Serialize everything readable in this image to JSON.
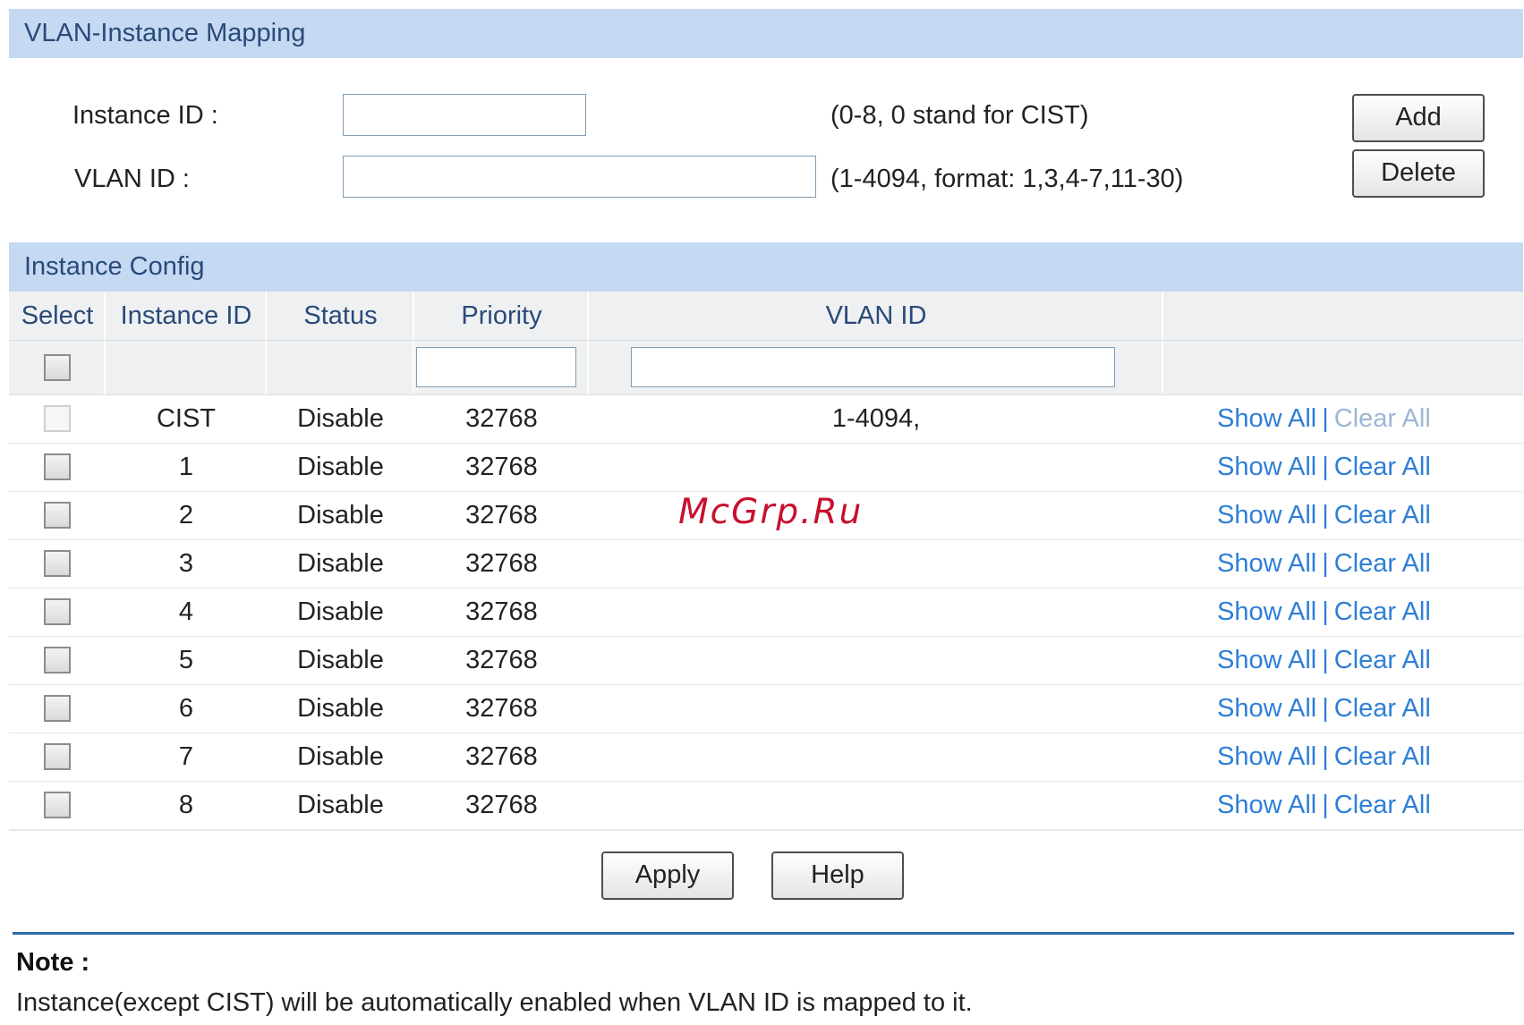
{
  "mapping": {
    "header": "VLAN-Instance Mapping",
    "instance_id_label": "Instance ID :",
    "instance_id_value": "",
    "instance_id_hint": "(0-8, 0 stand for CIST)",
    "vlan_id_label": "VLAN ID :",
    "vlan_id_value": "",
    "vlan_id_hint": "(1-4094, format: 1,3,4-7,11-30)",
    "add_label": "Add",
    "delete_label": "Delete"
  },
  "config": {
    "header": "Instance Config",
    "columns": {
      "select": "Select",
      "instance_id": "Instance ID",
      "status": "Status",
      "priority": "Priority",
      "vlan_id": "VLAN ID"
    },
    "filter": {
      "priority": "",
      "vlan_id": ""
    },
    "rows": [
      {
        "instance": "CIST",
        "status": "Disable",
        "priority": "32768",
        "vlan": "1-4094,",
        "show": "Show All",
        "clear": "Clear All",
        "select_disabled": true
      },
      {
        "instance": "1",
        "status": "Disable",
        "priority": "32768",
        "vlan": "",
        "show": "Show All",
        "clear": "Clear All",
        "select_disabled": false
      },
      {
        "instance": "2",
        "status": "Disable",
        "priority": "32768",
        "vlan": "",
        "show": "Show All",
        "clear": "Clear All",
        "select_disabled": false
      },
      {
        "instance": "3",
        "status": "Disable",
        "priority": "32768",
        "vlan": "",
        "show": "Show All",
        "clear": "Clear All",
        "select_disabled": false
      },
      {
        "instance": "4",
        "status": "Disable",
        "priority": "32768",
        "vlan": "",
        "show": "Show All",
        "clear": "Clear All",
        "select_disabled": false
      },
      {
        "instance": "5",
        "status": "Disable",
        "priority": "32768",
        "vlan": "",
        "show": "Show All",
        "clear": "Clear All",
        "select_disabled": false
      },
      {
        "instance": "6",
        "status": "Disable",
        "priority": "32768",
        "vlan": "",
        "show": "Show All",
        "clear": "Clear All",
        "select_disabled": false
      },
      {
        "instance": "7",
        "status": "Disable",
        "priority": "32768",
        "vlan": "",
        "show": "Show All",
        "clear": "Clear All",
        "select_disabled": false
      },
      {
        "instance": "8",
        "status": "Disable",
        "priority": "32768",
        "vlan": "",
        "show": "Show All",
        "clear": "Clear All",
        "select_disabled": false
      }
    ],
    "link_separator": "|",
    "apply_label": "Apply",
    "help_label": "Help"
  },
  "watermark": "McGrp.Ru",
  "note": {
    "title": "Note :",
    "text": "Instance(except CIST) will be automatically enabled when VLAN ID is mapped to it."
  },
  "colors": {
    "header_bg": "#c6d9f3",
    "header_text": "#2a4a78",
    "link": "#2f7fd6",
    "watermark": "#c8102e"
  }
}
